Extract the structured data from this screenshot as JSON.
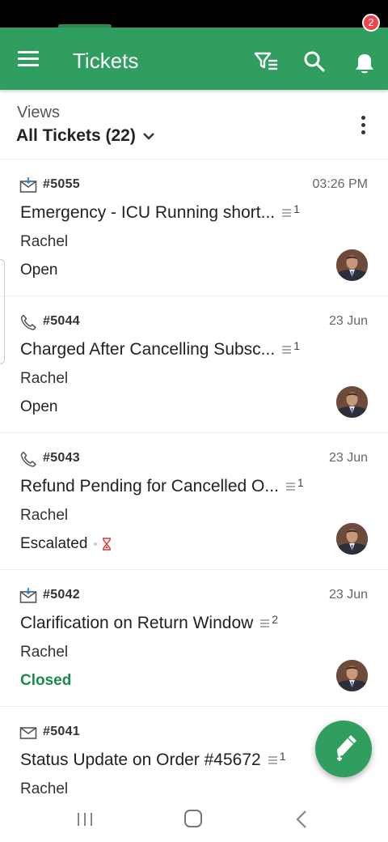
{
  "app": {
    "title": "Tickets",
    "notification_count": "2",
    "accent_color": "#2f9e5f"
  },
  "views": {
    "caption": "Views",
    "selected": "All Tickets (22)"
  },
  "tickets": [
    {
      "icon": "email-in-icon",
      "id": "#5055",
      "date": "03:26 PM",
      "subject": "Emergency - ICU Running short...",
      "thread_count": "1",
      "requester": "Rachel",
      "status": "Open"
    },
    {
      "icon": "phone-icon",
      "id": "#5044",
      "date": "23 Jun",
      "subject": "Charged After Cancelling Subsc...",
      "thread_count": "1",
      "requester": "Rachel",
      "status": "Open"
    },
    {
      "icon": "phone-icon",
      "id": "#5043",
      "date": "23 Jun",
      "subject": "Refund Pending for Cancelled O...",
      "thread_count": "1",
      "requester": "Rachel",
      "status": "Escalated"
    },
    {
      "icon": "email-in-icon",
      "id": "#5042",
      "date": "23 Jun",
      "subject": "Clarification on Return Window",
      "thread_count": "2",
      "requester": "Rachel",
      "status": "Closed"
    },
    {
      "icon": "email-icon",
      "id": "#5041",
      "date": "",
      "subject": "Status Update on Order #45672",
      "thread_count": "1",
      "requester": "Rachel",
      "status": ""
    }
  ]
}
